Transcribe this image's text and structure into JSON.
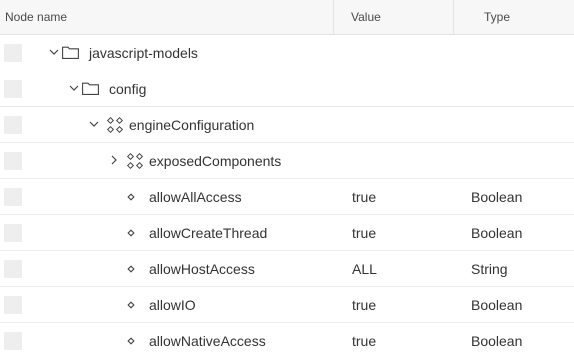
{
  "columns": {
    "name": "Node name",
    "value": "Value",
    "type": "Type"
  },
  "rows": [
    {
      "name": "javascript-models",
      "value": "",
      "type": "",
      "kind": "folder",
      "state": "expanded"
    },
    {
      "name": "config",
      "value": "",
      "type": "",
      "kind": "folder",
      "state": "expanded"
    },
    {
      "name": "engineConfiguration",
      "value": "",
      "type": "",
      "kind": "component",
      "state": "expanded"
    },
    {
      "name": "exposedComponents",
      "value": "",
      "type": "",
      "kind": "component",
      "state": "collapsed"
    },
    {
      "name": "allowAllAccess",
      "value": "true",
      "type": "Boolean",
      "kind": "property"
    },
    {
      "name": "allowCreateThread",
      "value": "true",
      "type": "Boolean",
      "kind": "property"
    },
    {
      "name": "allowHostAccess",
      "value": "ALL",
      "type": "String",
      "kind": "property"
    },
    {
      "name": "allowIO",
      "value": "true",
      "type": "Boolean",
      "kind": "property"
    },
    {
      "name": "allowNativeAccess",
      "value": "true",
      "type": "Boolean",
      "kind": "property"
    }
  ]
}
